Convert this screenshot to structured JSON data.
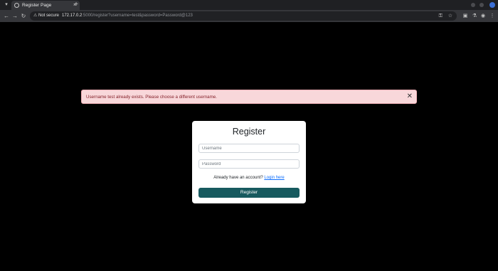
{
  "browser": {
    "tab_title": "Register Page",
    "tab_close": "×",
    "new_tab": "+",
    "tab_menu": "▾",
    "not_secure": "Not secure",
    "url_host": "172.17.0.2",
    "url_path": ":5000/register?username=test&password=Password@123"
  },
  "alert": {
    "message": "Username test already exists. Please choose a different username.",
    "close": "✕"
  },
  "form": {
    "title": "Register",
    "username_placeholder": "Username",
    "password_placeholder": "Password",
    "login_prompt": "Already have an account?",
    "login_link": "Login here",
    "submit_label": "Register"
  },
  "colors": {
    "accent": "#175a5f",
    "alert_bg": "#f8d7da",
    "alert_text": "#842029"
  }
}
